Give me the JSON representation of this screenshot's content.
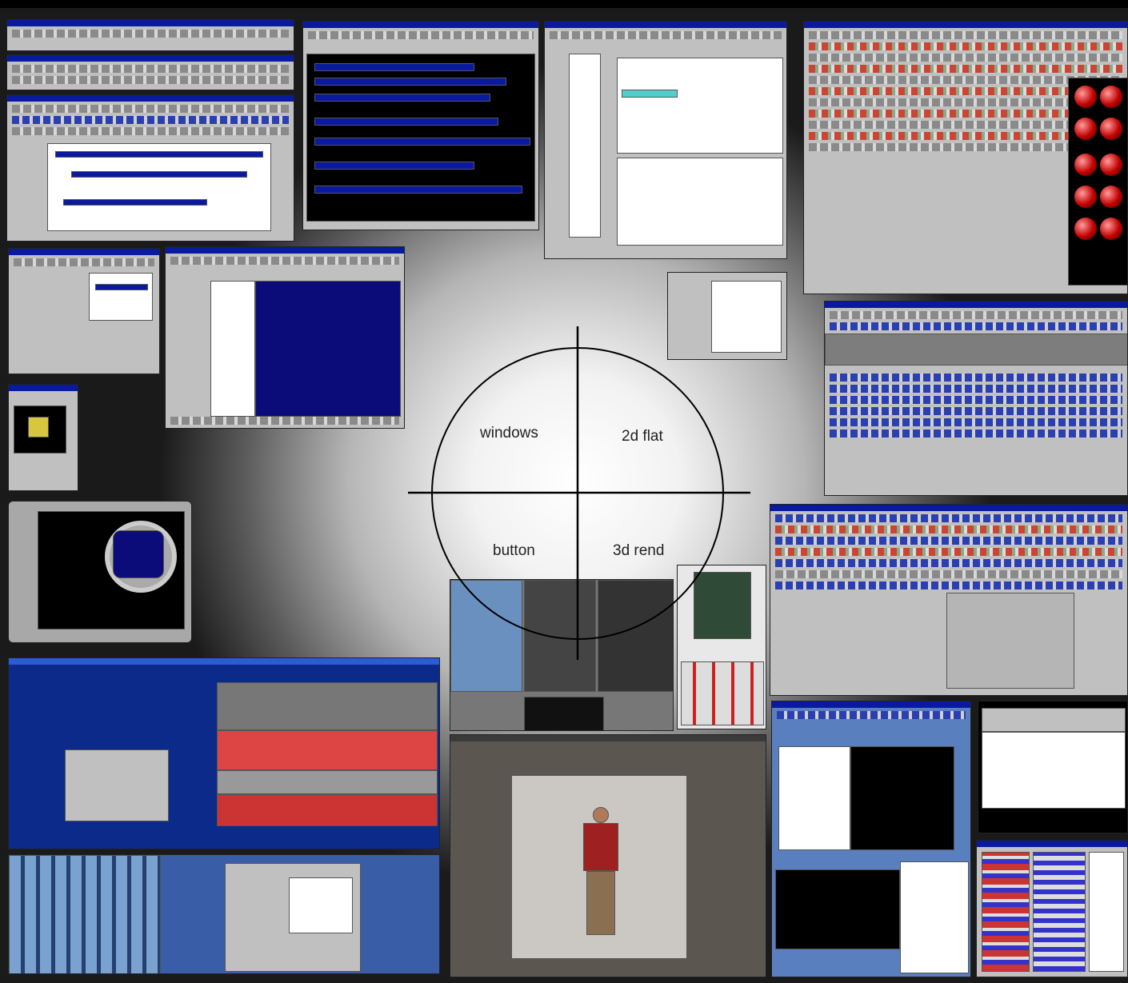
{
  "quadrants": {
    "top_left": "windows",
    "top_right": "2d flat",
    "bottom_left": "button",
    "bottom_right": "3d rend"
  },
  "colors": {
    "window_title": "#0a1aa0",
    "window_gray": "#c0c0c0",
    "viewport_navy": "#0b0b7a",
    "diagram_stroke": "#000000"
  },
  "icons": [
    "circle-quadrant-diagram",
    "material-sphere-icon"
  ]
}
